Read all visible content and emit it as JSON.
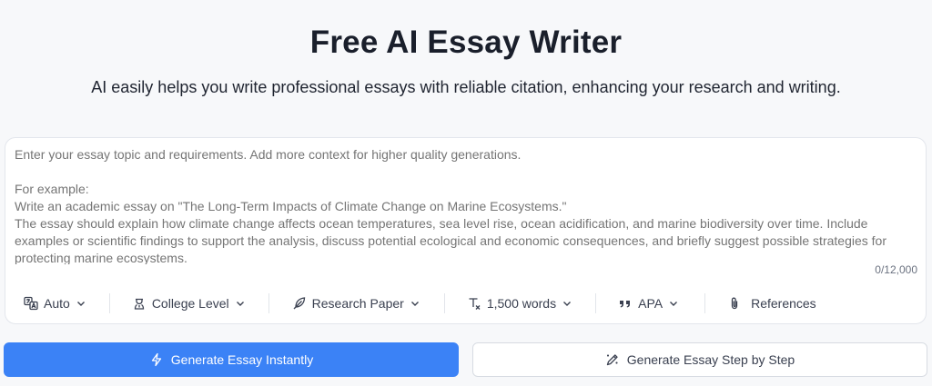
{
  "header": {
    "title": "Free AI Essay Writer",
    "subtitle": "AI easily helps you write professional essays with reliable citation, enhancing your research and writing."
  },
  "composer": {
    "placeholder": "Enter your essay topic and requirements. Add more context for higher quality generations.\n\nFor example:\nWrite an academic essay on \"The Long-Term Impacts of Climate Change on Marine Ecosystems.\"\nThe essay should explain how climate change affects ocean temperatures, sea level rise, ocean acidification, and marine biodiversity over time. Include examples or scientific findings to support the analysis, discuss potential ecological and economic consequences, and briefly suggest possible strategies for protecting marine ecosystems.",
    "value": "",
    "char_count": "0/12,000"
  },
  "toolbar": {
    "language": {
      "label": "Auto",
      "icon": "translate-icon"
    },
    "level": {
      "label": "College Level",
      "icon": "student-icon"
    },
    "type": {
      "label": "Research Paper",
      "icon": "feather-pen-icon"
    },
    "length": {
      "label": "1,500 words",
      "icon": "text-format-icon"
    },
    "citation": {
      "label": "APA",
      "icon": "quote-icon"
    },
    "references": {
      "label": "References",
      "icon": "paperclip-icon"
    }
  },
  "actions": {
    "instant_label": "Generate Essay Instantly",
    "step_label": "Generate Essay Step by Step"
  },
  "colors": {
    "primary": "#3b82f6",
    "background": "#f7f8fa",
    "placeholder_text": "#b4b9c2"
  }
}
